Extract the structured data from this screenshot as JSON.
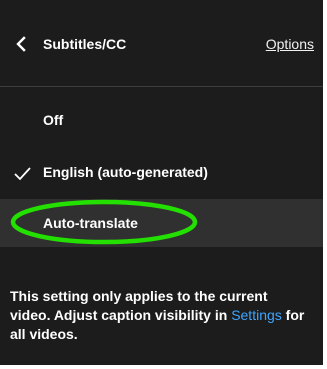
{
  "header": {
    "back_icon": "chevron-left-icon",
    "title": "Subtitles/CC",
    "options_label": "Options"
  },
  "menu": {
    "items": [
      {
        "label": "Off",
        "selected": false
      },
      {
        "label": "English (auto-generated)",
        "selected": true,
        "icon": "checkmark-icon"
      },
      {
        "label": "Auto-translate",
        "selected": false,
        "highlighted": true
      }
    ]
  },
  "annotation": {
    "shape": "ellipse",
    "color": "#23e000"
  },
  "footer": {
    "text_before": "This setting only applies to the current video. Adjust caption visibility in ",
    "link_text": "Settings",
    "text_after": " for all videos."
  },
  "colors": {
    "panel_background": "#1c1c1c",
    "highlight_background": "#303030",
    "link": "#3ea6ff",
    "text": "#ffffff"
  }
}
